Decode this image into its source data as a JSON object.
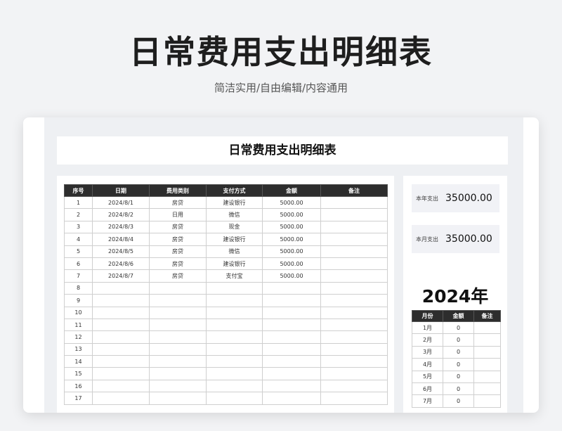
{
  "hero": {
    "title": "日常费用支出明细表",
    "subtitle": "简洁实用/自由编辑/内容通用"
  },
  "sheet": {
    "title": "日常费用支出明细表",
    "columns": [
      "序号",
      "日期",
      "费用类别",
      "支付方式",
      "金额",
      "备注"
    ],
    "rows": [
      [
        "1",
        "2024/8/1",
        "房贷",
        "建设银行",
        "5000.00",
        ""
      ],
      [
        "2",
        "2024/8/2",
        "日用",
        "微信",
        "5000.00",
        ""
      ],
      [
        "3",
        "2024/8/3",
        "房贷",
        "现金",
        "5000.00",
        ""
      ],
      [
        "4",
        "2024/8/4",
        "房贷",
        "建设银行",
        "5000.00",
        ""
      ],
      [
        "5",
        "2024/8/5",
        "房贷",
        "微信",
        "5000.00",
        ""
      ],
      [
        "6",
        "2024/8/6",
        "房贷",
        "建设银行",
        "5000.00",
        ""
      ],
      [
        "7",
        "2024/8/7",
        "房贷",
        "支付宝",
        "5000.00",
        ""
      ],
      [
        "8",
        "",
        "",
        "",
        "",
        ""
      ],
      [
        "9",
        "",
        "",
        "",
        "",
        ""
      ],
      [
        "10",
        "",
        "",
        "",
        "",
        ""
      ],
      [
        "11",
        "",
        "",
        "",
        "",
        ""
      ],
      [
        "12",
        "",
        "",
        "",
        "",
        ""
      ],
      [
        "13",
        "",
        "",
        "",
        "",
        ""
      ],
      [
        "14",
        "",
        "",
        "",
        "",
        ""
      ],
      [
        "15",
        "",
        "",
        "",
        "",
        ""
      ],
      [
        "16",
        "",
        "",
        "",
        "",
        ""
      ],
      [
        "17",
        "",
        "",
        "",
        "",
        ""
      ]
    ]
  },
  "summary": {
    "year_total_label": "本年支出",
    "year_total_value": "35000.00",
    "month_total_label": "本月支出",
    "month_total_value": "35000.00",
    "year": "2024年",
    "month_columns": [
      "月份",
      "金额",
      "备注"
    ],
    "months": [
      [
        "1月",
        "0",
        ""
      ],
      [
        "2月",
        "0",
        ""
      ],
      [
        "3月",
        "0",
        ""
      ],
      [
        "4月",
        "0",
        ""
      ],
      [
        "5月",
        "0",
        ""
      ],
      [
        "6月",
        "0",
        ""
      ],
      [
        "7月",
        "0",
        ""
      ]
    ]
  }
}
